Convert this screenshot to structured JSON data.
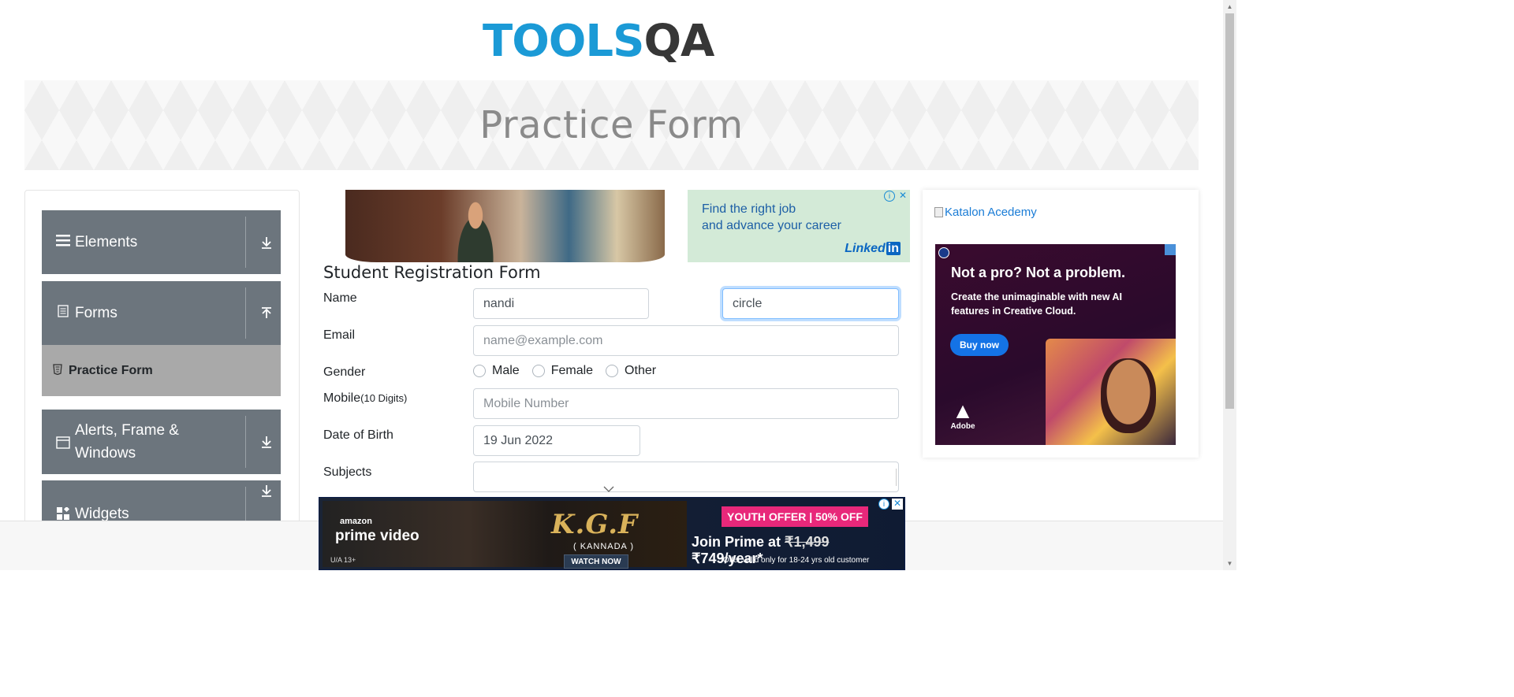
{
  "logo": {
    "text_main": "TOOLS",
    "text_accent": "QA"
  },
  "banner": {
    "title": "Practice Form"
  },
  "sidebar": {
    "groups": [
      {
        "label": "Elements",
        "icon": "hamburger-icon",
        "arrow": "download-arrow-icon"
      },
      {
        "label": "Forms",
        "icon": "document-icon",
        "arrow": "upload-arrow-icon"
      },
      {
        "label": "Alerts, Frame & Windows",
        "icon": "window-icon",
        "arrow": "download-arrow-icon"
      },
      {
        "label": "Widgets",
        "icon": "widgets-icon",
        "arrow": "download-arrow-icon"
      }
    ],
    "active_item": {
      "label": "Practice Form",
      "icon": "html5-icon"
    }
  },
  "ads": {
    "linkedin": {
      "text_line1": "Find the right job",
      "text_line2": "and advance your career",
      "brand": "Linked",
      "brand_in": "in"
    },
    "katalon": {
      "alt": "Katalon Acedemy"
    },
    "adobe": {
      "headline": "Not a pro? Not a problem.",
      "body": "Create the unimaginable with new AI features in Creative Cloud.",
      "cta": "Buy now",
      "brand": "Adobe"
    },
    "bottom": {
      "amazon": "amazon",
      "prime": "prime video",
      "rating": "U/A 13+",
      "movie": "K.G.F",
      "language": "( KANNADA )",
      "watch": "WATCH NOW",
      "offer_badge": "YOUTH OFFER | 50% OFF",
      "join_prefix": "Join Prime at ",
      "old_price": "₹1,499",
      "new_price": " ₹749/year*",
      "fine_print": "*Offer valid only for 18-24 yrs old customer"
    }
  },
  "form": {
    "title": "Student Registration Form",
    "name_label": "Name",
    "first_name_value": "nandi",
    "last_name_value": "circle",
    "email_label": "Email",
    "email_placeholder": "name@example.com",
    "gender_label": "Gender",
    "gender_options": [
      "Male",
      "Female",
      "Other"
    ],
    "mobile_label": "Mobile",
    "mobile_hint": "(10 Digits)",
    "mobile_placeholder": "Mobile Number",
    "dob_label": "Date of Birth",
    "dob_value": "19 Jun 2022",
    "subjects_label": "Subjects"
  },
  "colors": {
    "brand_blue": "#1b9ad6",
    "nav_group": "#6c757d",
    "nav_active": "#a9a9a9",
    "focus_border": "#80bdff"
  }
}
